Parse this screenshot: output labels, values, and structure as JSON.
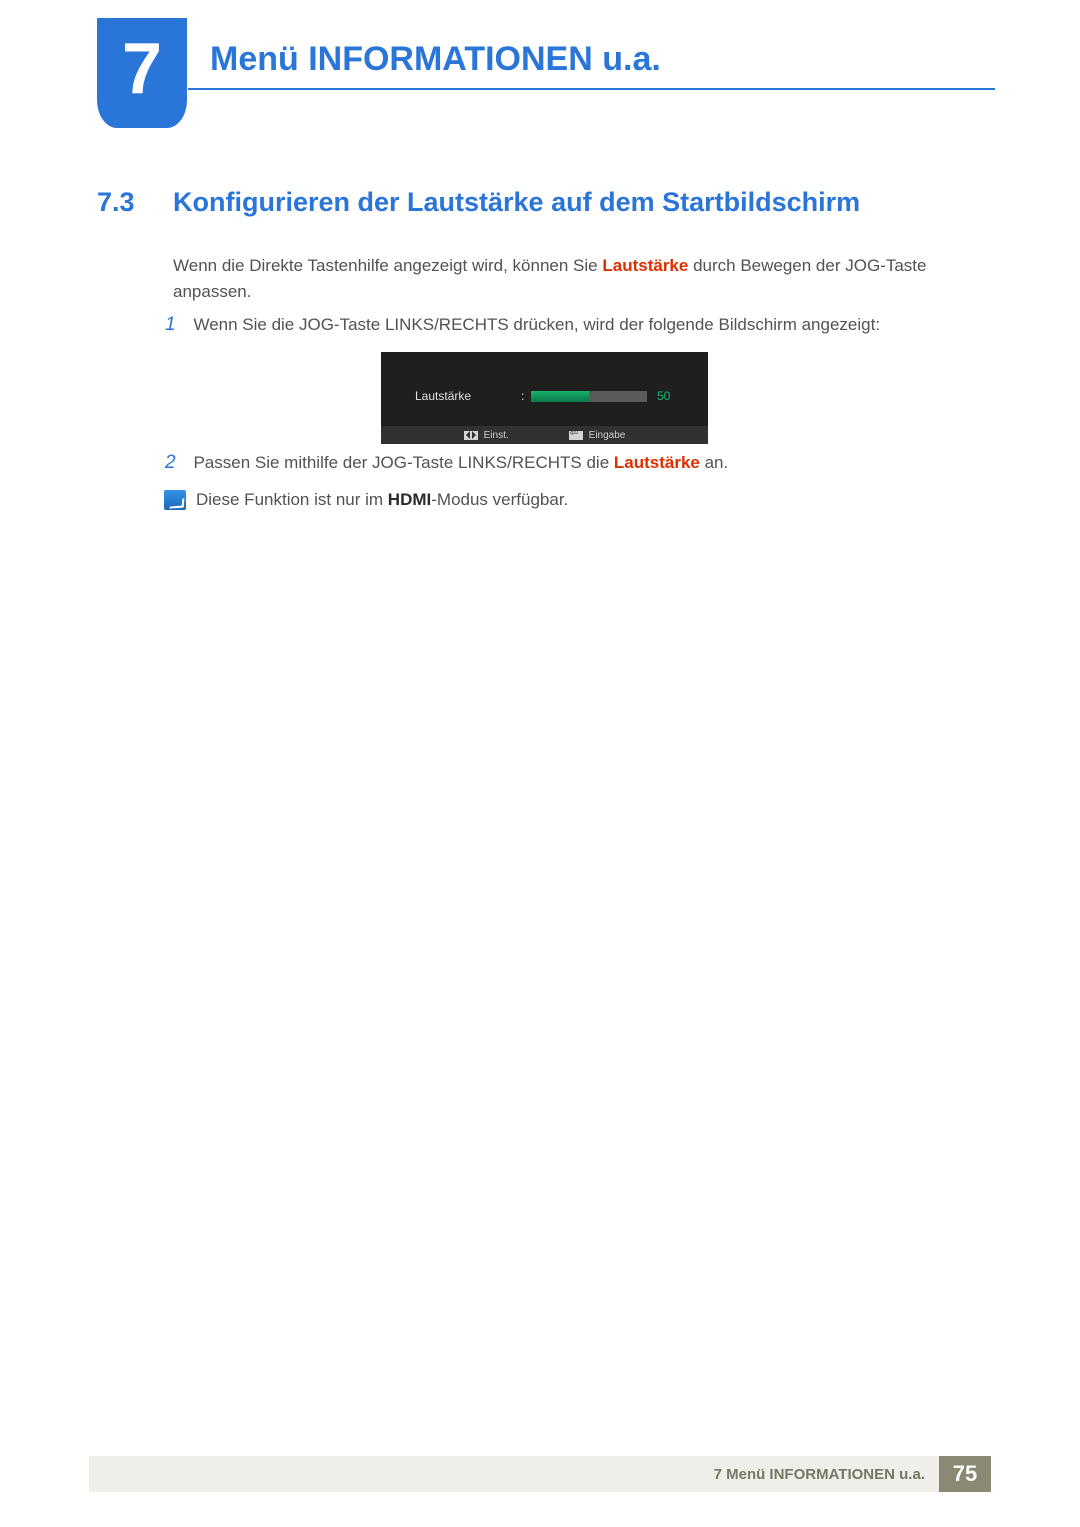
{
  "chapter": {
    "number": "7",
    "title": "Menü INFORMATIONEN u.a."
  },
  "section": {
    "number": "7.3",
    "title": "Konfigurieren der Lautstärke auf dem Startbildschirm"
  },
  "intro": {
    "pre": "Wenn die Direkte Tastenhilfe angezeigt wird, können Sie ",
    "hl": "Lautstärke",
    "post": " durch Bewegen der JOG-Taste anpassen."
  },
  "steps": {
    "s1_num": "1",
    "s1_txt": "Wenn Sie die JOG-Taste LINKS/RECHTS drücken, wird der folgende Bildschirm angezeigt:",
    "s2_num": "2",
    "s2_pre": "Passen Sie mithilfe der JOG-Taste LINKS/RECHTS die ",
    "s2_hl": "Lautstärke",
    "s2_post": " an."
  },
  "osd": {
    "label": "Lautstärke",
    "colon": ":",
    "value": "50",
    "adjust": "Einst.",
    "enter": "Eingabe"
  },
  "note": {
    "pre": "Diese Funktion ist nur im ",
    "hl": "HDMI",
    "post": "-Modus verfügbar."
  },
  "footer": {
    "text": "7 Menü INFORMATIONEN u.a.",
    "page": "75"
  }
}
